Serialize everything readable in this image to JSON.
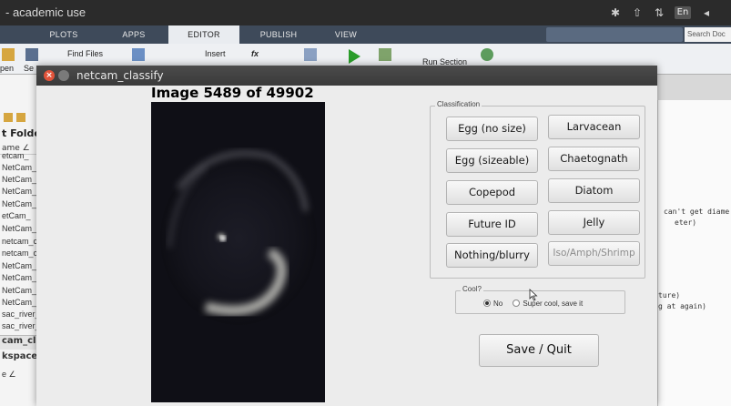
{
  "ide": {
    "window_title": "- academic use",
    "tabs": [
      "PLOTS",
      "APPS",
      "EDITOR",
      "PUBLISH",
      "VIEW"
    ],
    "active_tab": "EDITOR",
    "search_placeholder": "Search Doc",
    "tray_lang": "En",
    "ribbon": {
      "find_files": "Find Files",
      "insert": "Insert",
      "fx": "fx",
      "run_section": "Run Section",
      "open_partial": "pen",
      "se_partial": "Se"
    },
    "left_pane": {
      "header": "t Folde",
      "column": "ame ∠",
      "files": [
        "etcam_",
        "NetCam_",
        "NetCam_",
        "NetCam_",
        "NetCam_",
        "etCam_",
        "NetCam_",
        "netcam_c",
        "netcam_c",
        "NetCam_I",
        "NetCam_l",
        "NetCam_l",
        "NetCam_r",
        "sac_river_",
        "sac_river_"
      ],
      "section1": "cam_classi",
      "section2": "kspace",
      "section3": "e ∠"
    },
    "editor_lines": [
      "can't get diame",
      "eter)",
      "ture)",
      "g at again)"
    ]
  },
  "dialog": {
    "title": "netcam_classify",
    "image_counter": "Image 5489 of 49902",
    "classification_label": "Classification",
    "buttons": [
      "Egg (no size)",
      "Larvacean",
      "Egg (sizeable)",
      "Chaetognath",
      "Copepod",
      "Diatom",
      "Future ID",
      "Jelly",
      "Nothing/blurry",
      "Iso/Amph/Shrimp"
    ],
    "disabled_button": "Iso/Amph/Shrimp",
    "cool_label": "Cool?",
    "cool_options": [
      "No",
      "Super cool, save it"
    ],
    "cool_selected": "No",
    "save_quit": "Save / Quit"
  },
  "colors": {
    "dialog_bg": "#ececec",
    "titlebar": "#3a3a3a",
    "close_red": "#e2533a",
    "ribbon_tabs": "#3e4a5a"
  }
}
